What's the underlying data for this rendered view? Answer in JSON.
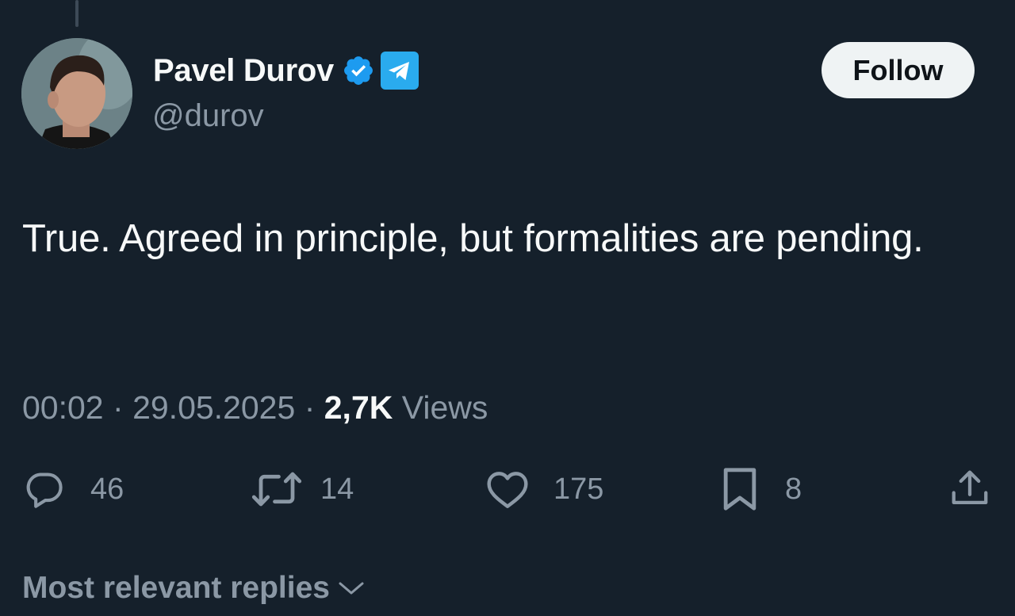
{
  "tweet": {
    "author": {
      "display_name": "Pavel Durov",
      "handle": "@durov",
      "verified_icon": "verified-badge-icon",
      "affiliate_icon": "telegram-icon"
    },
    "follow_label": "Follow",
    "text": "True. Agreed in principle, but formalities are pending.",
    "time": "00:02",
    "date": "29.05.2025",
    "views_count": "2,7K",
    "views_label": "Views",
    "separator": "·"
  },
  "actions": {
    "replies": "46",
    "reposts": "14",
    "likes": "175",
    "bookmarks": "8"
  },
  "replies_sort_label": "Most relevant replies",
  "colors": {
    "background": "#15202b",
    "primary_text": "#f7f9f9",
    "secondary_text": "#8b98a5",
    "verified_blue": "#1d9bf0",
    "telegram_blue": "#2aabee",
    "follow_bg": "#eff3f4"
  }
}
